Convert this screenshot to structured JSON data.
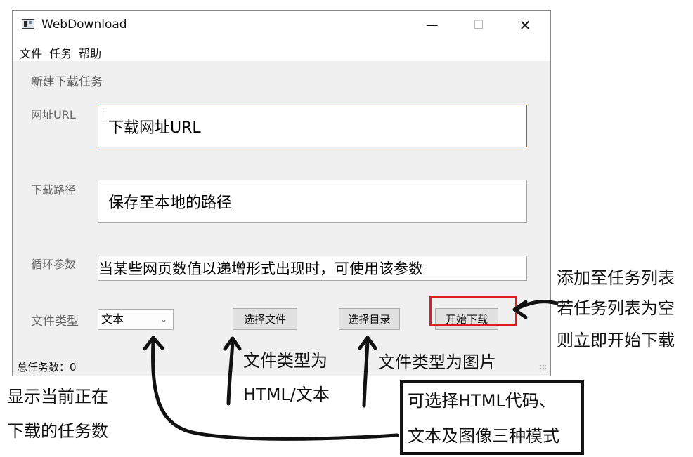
{
  "window": {
    "title": "WebDownload",
    "controls": {
      "minimize": "—",
      "maximize": "☐",
      "close": "✕"
    }
  },
  "menu": {
    "items": [
      "文件",
      "任务",
      "帮助"
    ]
  },
  "form": {
    "section_title": "新建下载任务",
    "url": {
      "label": "网址URL",
      "value": "下载网址URL"
    },
    "path": {
      "label": "下载路径",
      "value": "保存至本地的路径"
    },
    "loop": {
      "label": "循环参数",
      "value": "当某些网页数值以递增形式出现时，可使用该参数"
    },
    "file_type": {
      "label": "文件类型",
      "selected": "文本"
    },
    "buttons": {
      "select_file": "选择文件",
      "select_dir": "选择目录",
      "start": "开始下载"
    }
  },
  "status": {
    "task_count": "总任务数：0"
  },
  "annotations": {
    "start_note": [
      "添加至任务列表",
      "若任务列表为空",
      "则立即开始下载"
    ],
    "select_file_note": [
      "文件类型为",
      "HTML/文本"
    ],
    "select_dir_note": "文件类型为图片",
    "count_note": [
      "显示当前正在",
      "下载的任务数"
    ],
    "mode_note": [
      "可选择HTML代码、",
      "文本及图像三种模式"
    ]
  },
  "colors": {
    "highlight": "#e21b1b",
    "focus_border": "#2a7bd4"
  }
}
